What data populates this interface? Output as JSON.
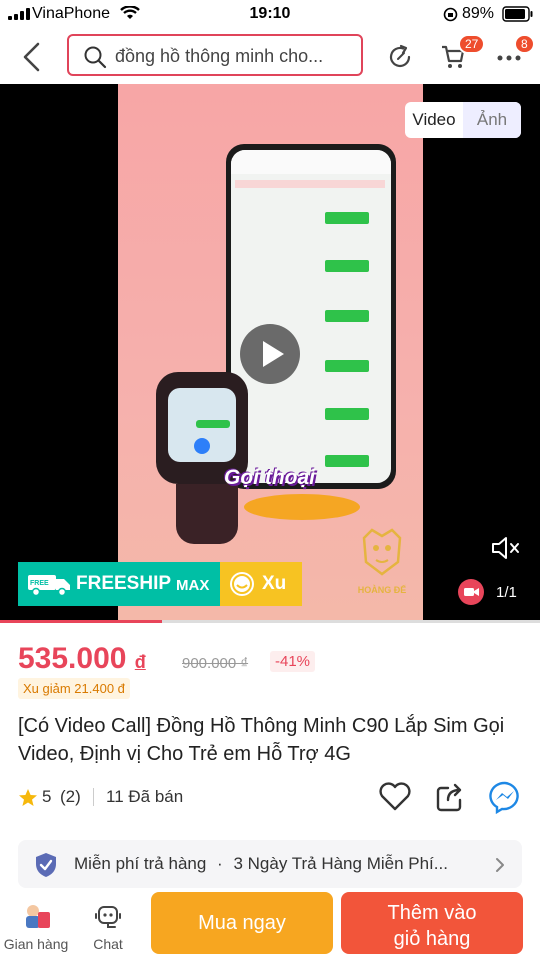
{
  "status_bar": {
    "carrier": "VinaPhone",
    "time": "19:10",
    "battery": "89%"
  },
  "header": {
    "search_text": "đồng hồ thông minh cho...",
    "cart_badge": "27",
    "more_badge": "8"
  },
  "media": {
    "tab_video": "Video",
    "tab_image": "Ảnh",
    "overlay_caption": "Gọi thoại",
    "freeship_label": "FREESHIP",
    "freeship_max": "MAX",
    "xu_label": "Xu",
    "brand_mark": "HOÀNG ĐẾ",
    "counter": "1/1",
    "progress": 0.3
  },
  "price": {
    "current": "535.000",
    "currency": "đ",
    "original": "900.000 ₫",
    "discount": "-41%",
    "coin_discount": "Xu giảm 21.400 đ"
  },
  "product": {
    "title": "[Có Video Call] Đồng Hồ Thông Minh C90 Lắp Sim Gọi Video, Định vị Cho Trẻ em Hỗ Trợ 4G"
  },
  "stats": {
    "rating": "5",
    "rating_count": "(2)",
    "sold": "11 Đã bán",
    "stars": 1
  },
  "return_policy": {
    "label": "Miễn phí trả hàng",
    "separator": "·",
    "detail": "3 Ngày Trả Hàng Miễn Phí..."
  },
  "bottom_bar": {
    "shop_label": "Gian hàng",
    "chat_label": "Chat",
    "buy_now": "Mua ngay",
    "add_cart_line1": "Thêm vào",
    "add_cart_line2": "giỏ hàng"
  },
  "colors": {
    "accent": "#ee4d2d",
    "price": "#e8455a",
    "buy_now": "#f7a620",
    "add_cart": "#f2553a",
    "freeship": "#00bfa5"
  }
}
